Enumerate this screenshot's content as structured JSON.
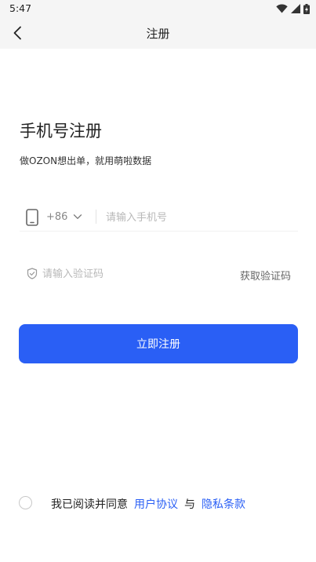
{
  "status_bar": {
    "time": "5:47",
    "icons": [
      "wifi-icon",
      "signal-icon",
      "battery-charging-icon"
    ]
  },
  "header": {
    "title": "注册",
    "back_icon": "chevron-left-icon"
  },
  "main": {
    "title": "手机号注册",
    "subtitle": "做OZON想出单，就用萌啦数据",
    "phone": {
      "icon": "phone-icon",
      "country_code": "+86",
      "placeholder": "请输入手机号",
      "value": ""
    },
    "code": {
      "icon": "shield-check-icon",
      "placeholder": "请输入验证码",
      "value": "",
      "get_code_label": "获取验证码"
    },
    "register_label": "立即注册"
  },
  "agreement": {
    "checked": false,
    "prefix": "我已阅读并同意",
    "user_agreement": "用户协议",
    "and": "与",
    "privacy_terms": "隐私条款"
  },
  "colors": {
    "accent": "#2a5ff5",
    "header_bg": "#f5f5f5",
    "placeholder": "#b8b8b8"
  }
}
